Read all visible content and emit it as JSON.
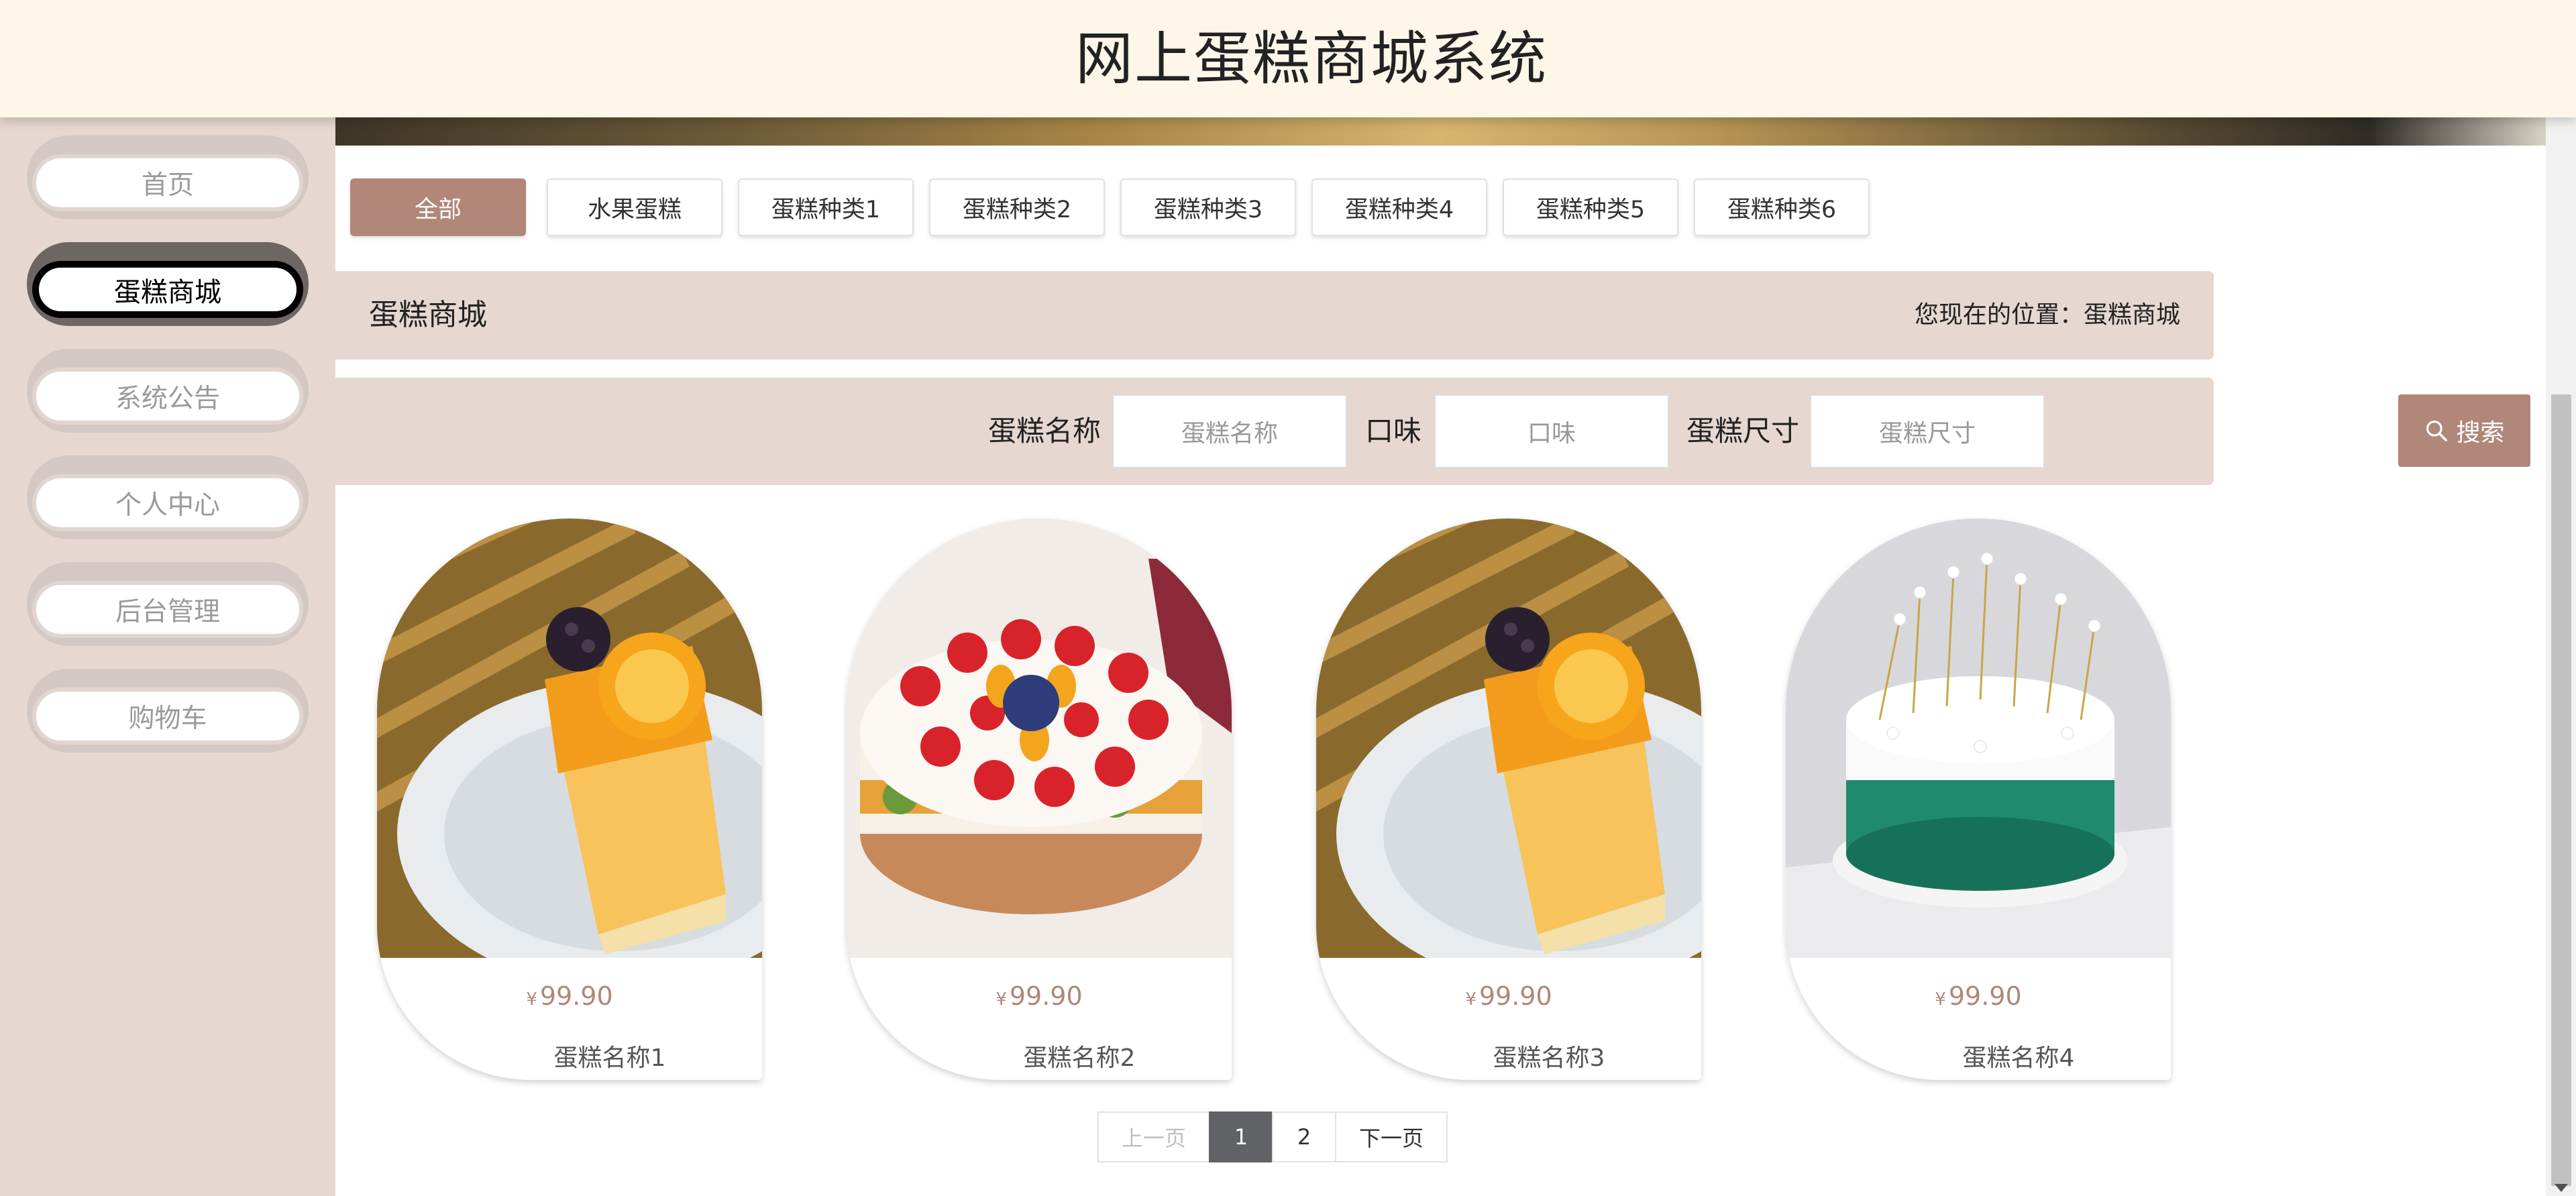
{
  "header": {
    "title": "网上蛋糕商城系统"
  },
  "sidebar": {
    "items": [
      {
        "label": "首页"
      },
      {
        "label": "蛋糕商城"
      },
      {
        "label": "系统公告"
      },
      {
        "label": "个人中心"
      },
      {
        "label": "后台管理"
      },
      {
        "label": "购物车"
      }
    ],
    "active_index": 1
  },
  "categories": [
    "全部",
    "水果蛋糕",
    "蛋糕种类1",
    "蛋糕种类2",
    "蛋糕种类3",
    "蛋糕种类4",
    "蛋糕种类5",
    "蛋糕种类6"
  ],
  "title_bar": {
    "title": "蛋糕商城",
    "location": "您现在的位置：蛋糕商城"
  },
  "search": {
    "name_label": "蛋糕名称",
    "name_placeholder": "蛋糕名称",
    "flavor_label": "口味",
    "flavor_placeholder": "口味",
    "size_label": "蛋糕尺寸",
    "size_placeholder": "蛋糕尺寸",
    "button_label": "搜索"
  },
  "products": [
    {
      "currency": "¥",
      "price": "99.90",
      "name": "蛋糕名称1",
      "image": "orange-cake-slice"
    },
    {
      "currency": "¥",
      "price": "99.90",
      "name": "蛋糕名称2",
      "image": "fruit-cake"
    },
    {
      "currency": "¥",
      "price": "99.90",
      "name": "蛋糕名称3",
      "image": "orange-cake-slice"
    },
    {
      "currency": "¥",
      "price": "99.90",
      "name": "蛋糕名称4",
      "image": "crown-cake"
    }
  ],
  "pagination": {
    "prev": "上一页",
    "pages": [
      "1",
      "2"
    ],
    "current": "1",
    "next": "下一页"
  },
  "colors": {
    "accent": "#b08779",
    "sidebar_bg": "#e6d8d1",
    "header_bg": "#fdf6e9"
  }
}
